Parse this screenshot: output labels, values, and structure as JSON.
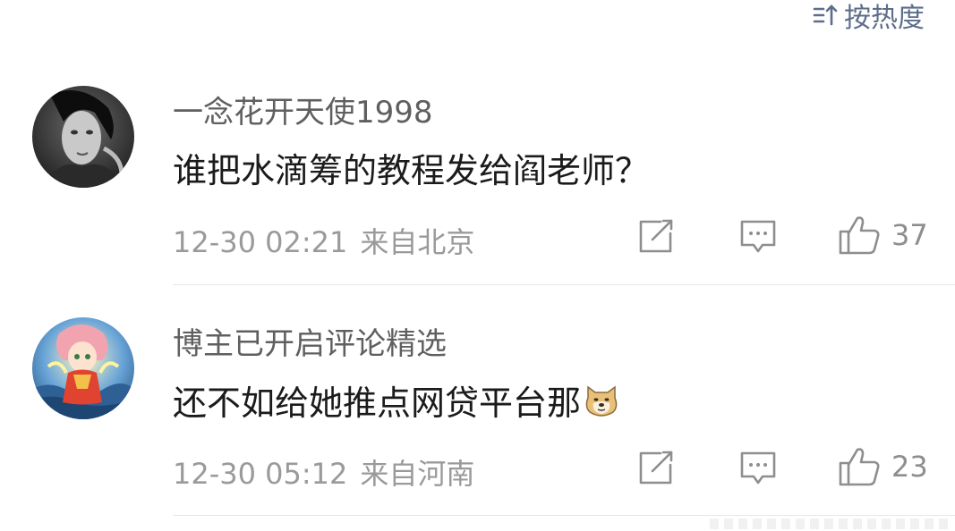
{
  "sort": {
    "label": "按热度",
    "icon": "sort-swap-icon"
  },
  "comments": [
    {
      "username": "一念花开天使1998",
      "text": "谁把水滴筹的教程发给阎老师？",
      "time": "12-30 02:21",
      "location": "来自北京",
      "likes": "37",
      "avatar": "black-and-white-portrait"
    },
    {
      "username": "博主已开启评论精选",
      "text": "还不如给她推点网贷平台那",
      "emoji": "doge-emoji",
      "time": "12-30 05:12",
      "location": "来自河南",
      "likes": "23",
      "avatar": "anime-girl-avatar"
    }
  ],
  "colors": {
    "accent": "#5d6d8a",
    "meta": "#9a9a9a",
    "username": "#5f5f5f",
    "icon": "#8e8e8e"
  }
}
